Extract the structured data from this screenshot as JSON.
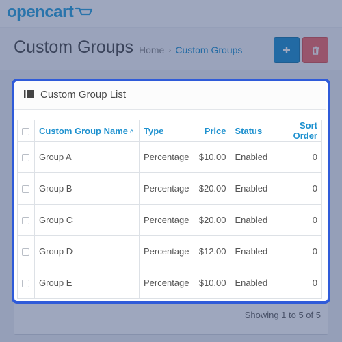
{
  "header": {
    "logo": "opencart"
  },
  "page": {
    "title": "Custom Groups",
    "breadcrumb": [
      "Home",
      "Custom Groups"
    ]
  },
  "panel": {
    "title": "Custom Group List",
    "columns": [
      "Custom Group Name",
      "Type",
      "Price",
      "Status",
      "Sort Order"
    ],
    "sorted_column": "Custom Group Name",
    "rows": [
      {
        "name": "Group A",
        "type": "Percentage",
        "price": "$10.00",
        "status": "Enabled",
        "sort": "0"
      },
      {
        "name": "Group B",
        "type": "Percentage",
        "price": "$20.00",
        "status": "Enabled",
        "sort": "0"
      },
      {
        "name": "Group C",
        "type": "Percentage",
        "price": "$20.00",
        "status": "Enabled",
        "sort": "0"
      },
      {
        "name": "Group D",
        "type": "Percentage",
        "price": "$12.00",
        "status": "Enabled",
        "sort": "0"
      },
      {
        "name": "Group E",
        "type": "Percentage",
        "price": "$10.00",
        "status": "Enabled",
        "sort": "0"
      }
    ]
  },
  "footer": {
    "pagination_text": "Showing 1 to 5 of 5"
  },
  "icons": {
    "add": "plus-icon",
    "delete": "trash-icon",
    "list": "list-icon"
  },
  "colors": {
    "accent": "#1e91cf",
    "danger": "#f56b6b",
    "highlight": "#2f5bd9"
  }
}
